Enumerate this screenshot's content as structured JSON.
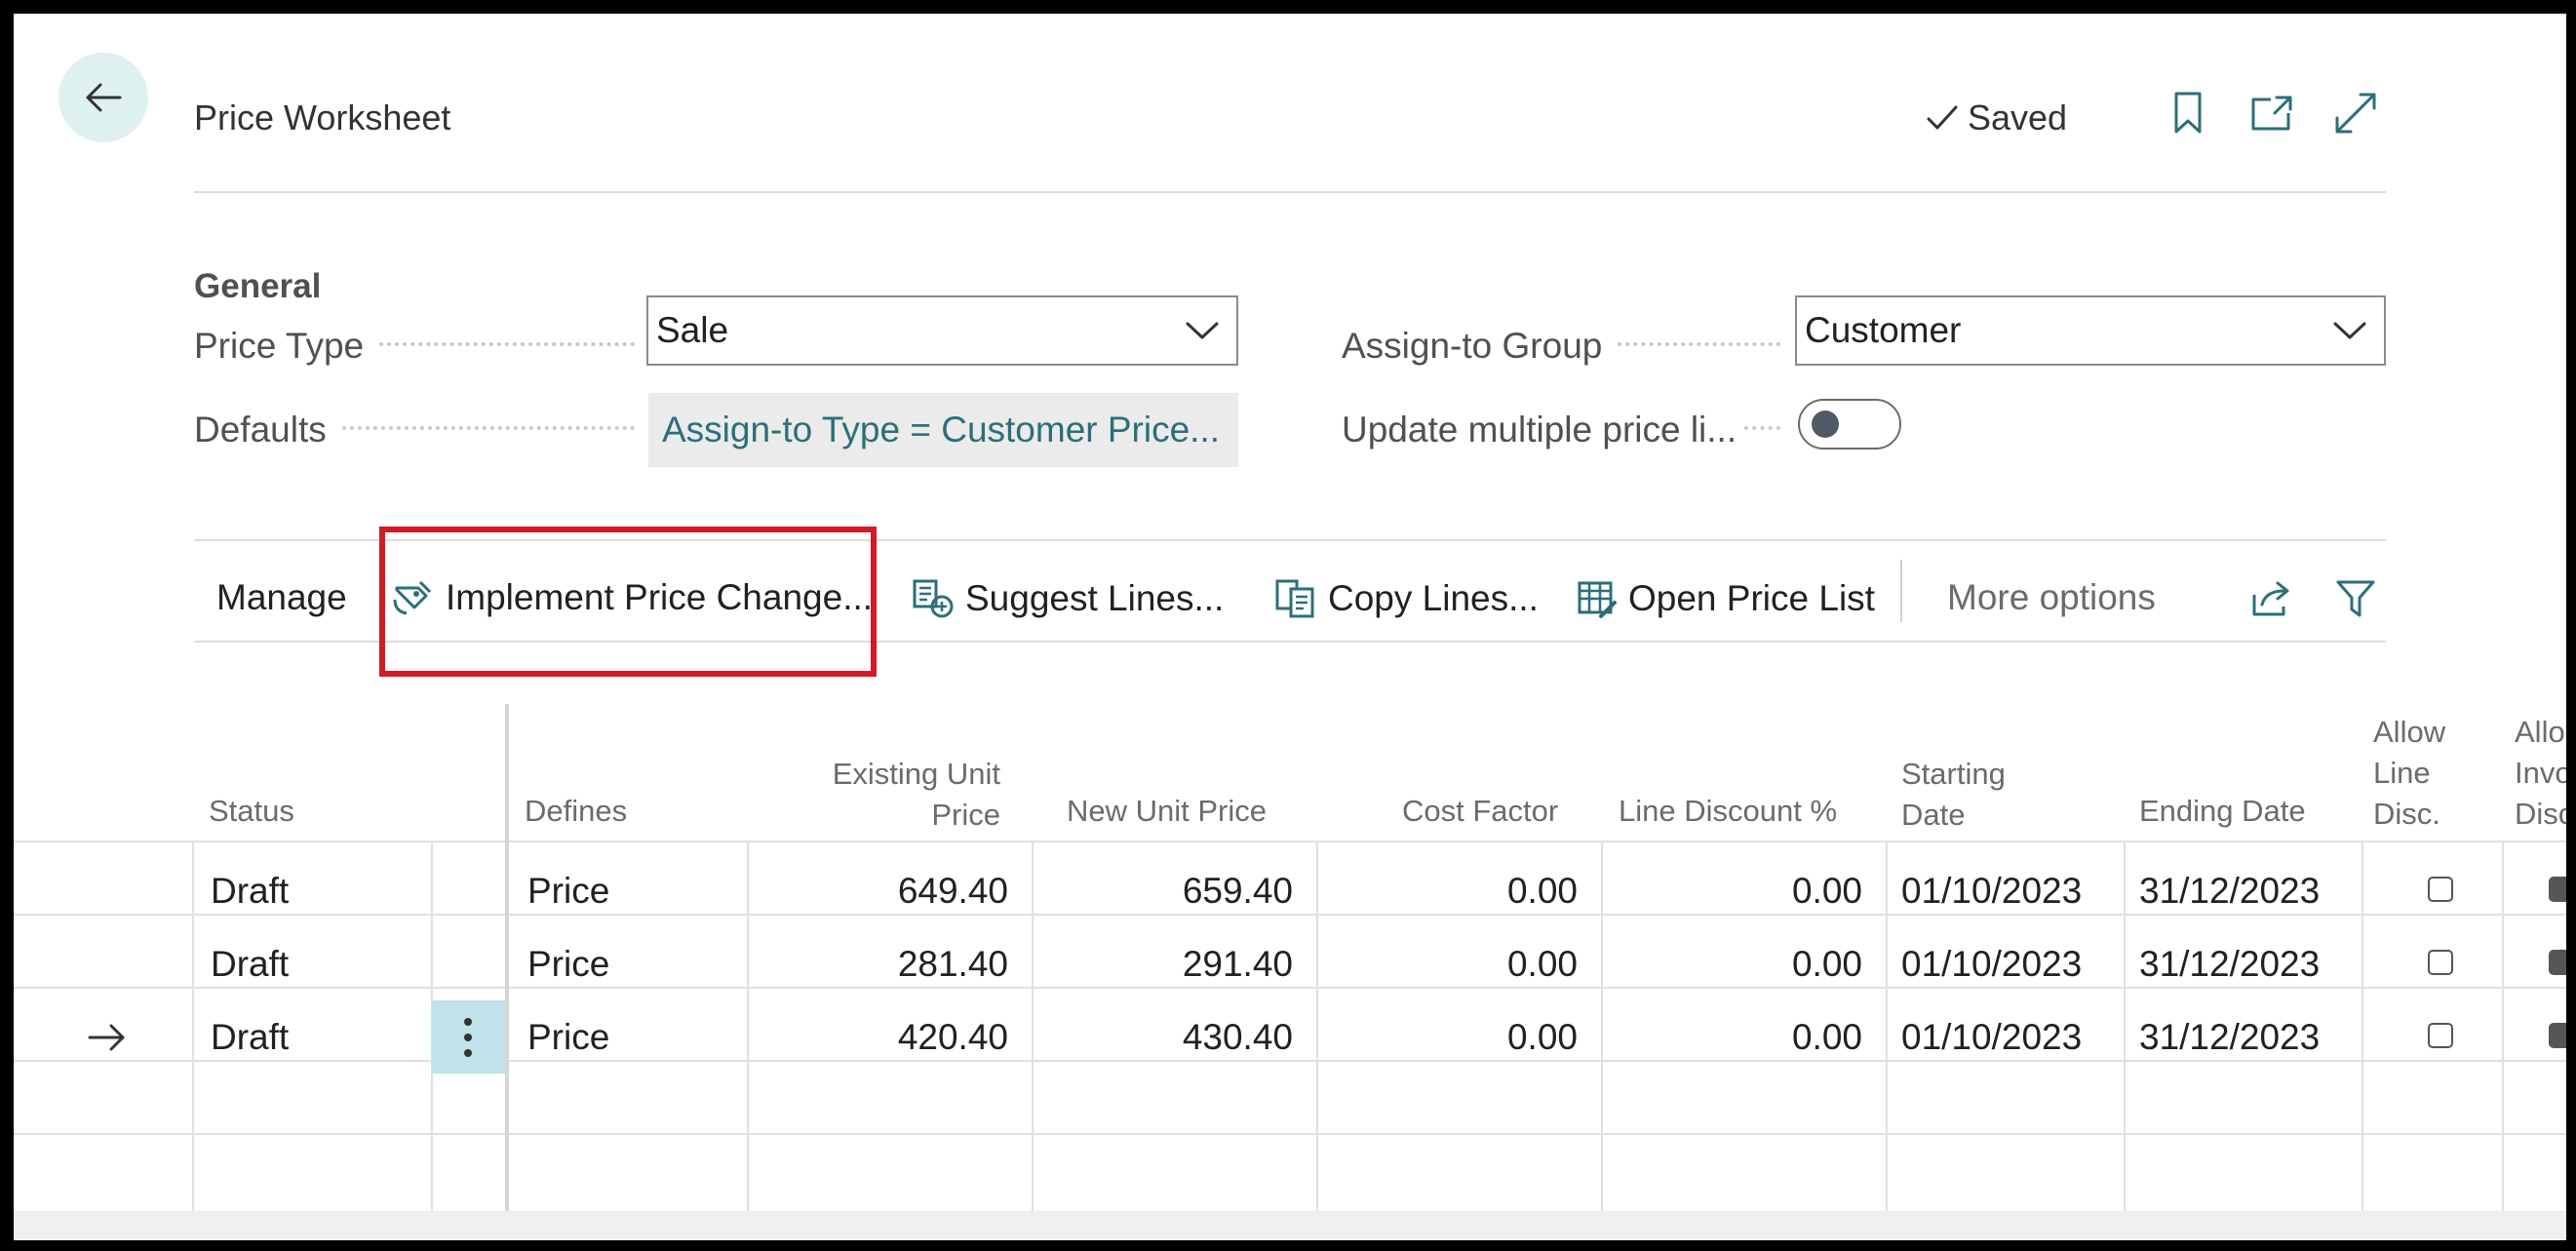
{
  "header": {
    "title": "Price Worksheet",
    "status": "Saved"
  },
  "general": {
    "section_title": "General",
    "price_type_label": "Price Type",
    "price_type_value": "Sale",
    "assign_group_label": "Assign-to Group",
    "assign_group_value": "Customer",
    "defaults_label": "Defaults",
    "defaults_value": "Assign-to Type = Customer Price...",
    "update_multiple_label": "Update multiple price li...",
    "update_multiple_on": false
  },
  "actions": {
    "manage": "Manage",
    "implement": "Implement Price Change...",
    "suggest": "Suggest Lines...",
    "copy": "Copy Lines...",
    "open_list": "Open Price List",
    "more": "More options"
  },
  "columns": {
    "status": "Status",
    "defines": "Defines",
    "existing_l1": "Existing Unit",
    "existing_l2": "Price",
    "new_price": "New Unit Price",
    "cost_factor": "Cost Factor",
    "line_discount": "Line Discount %",
    "starting_l1": "Starting",
    "starting_l2": "Date",
    "ending": "Ending Date",
    "allow_l1": "Allow",
    "allow_l2": "Line",
    "allow_l3": "Disc.",
    "allow_inv_l1": "Allo",
    "allow_inv_l2": "Invo",
    "allow_inv_l3": "Disc"
  },
  "rows": [
    {
      "status": "Draft",
      "defines": "Price",
      "existing": "649.40",
      "new_price": "659.40",
      "cost_factor": "0.00",
      "line_discount": "0.00",
      "starting": "01/10/2023",
      "ending": "31/12/2023",
      "allow_line_disc": false
    },
    {
      "status": "Draft",
      "defines": "Price",
      "existing": "281.40",
      "new_price": "291.40",
      "cost_factor": "0.00",
      "line_discount": "0.00",
      "starting": "01/10/2023",
      "ending": "31/12/2023",
      "allow_line_disc": false
    },
    {
      "status": "Draft",
      "defines": "Price",
      "existing": "420.40",
      "new_price": "430.40",
      "cost_factor": "0.00",
      "line_discount": "0.00",
      "starting": "01/10/2023",
      "ending": "31/12/2023",
      "allow_line_disc": false
    }
  ],
  "icons": {
    "back": "arrow-left-icon",
    "saved": "checkmark-icon",
    "bookmark": "bookmark-icon",
    "open_new": "open-in-new-window-icon",
    "expand": "expand-icon",
    "share": "share-icon",
    "filter": "filter-icon"
  },
  "colors": {
    "accent_teal": "#2b6f78",
    "back_button_bg": "#dff0f1",
    "highlight_red": "#d11a24",
    "selected_cell_bg": "#bfe3e8"
  }
}
